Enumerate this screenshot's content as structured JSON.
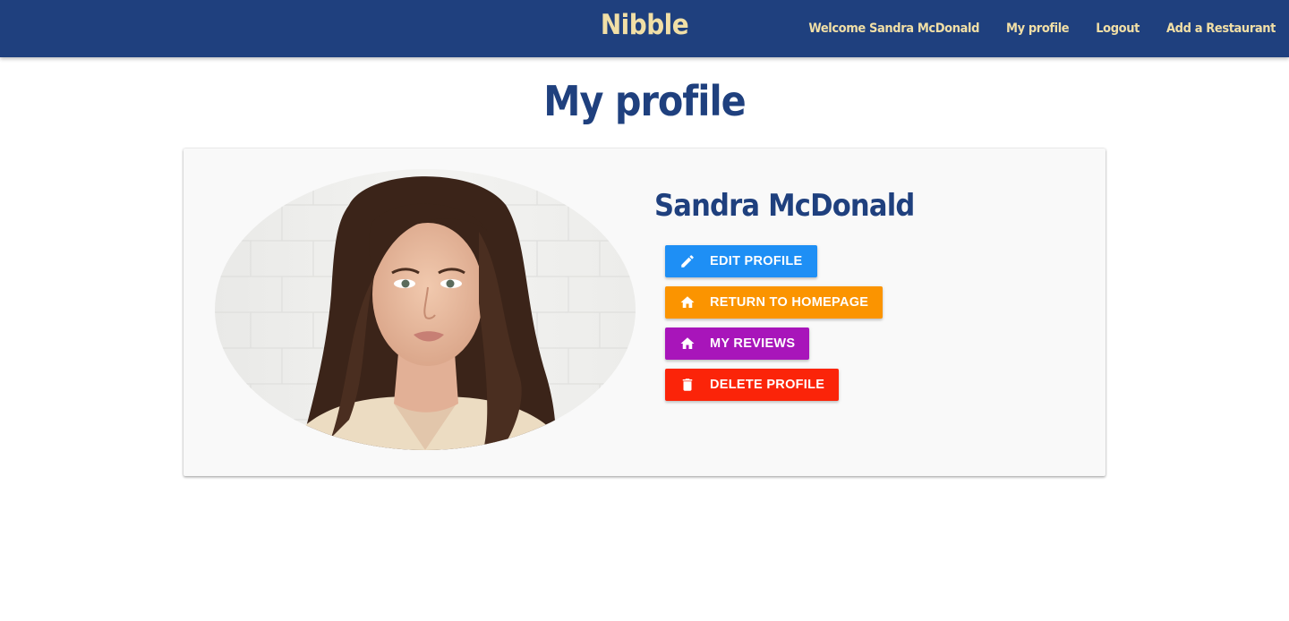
{
  "navbar": {
    "brand": "Nibble",
    "links": [
      {
        "label": "Welcome Sandra McDonald"
      },
      {
        "label": "My profile"
      },
      {
        "label": "Logout"
      },
      {
        "label": "Add a Restaurant"
      }
    ]
  },
  "page": {
    "title": "My profile"
  },
  "profile": {
    "name": "Sandra McDonald",
    "buttons": [
      {
        "label": "EDIT PROFILE",
        "icon": "pencil-icon",
        "color": "#1e8ff5"
      },
      {
        "label": "RETURN TO HOMEPAGE",
        "icon": "home-icon",
        "color": "#fb9400"
      },
      {
        "label": "MY REVIEWS",
        "icon": "home-icon",
        "color": "#a815ba"
      },
      {
        "label": "DELETE PROFILE",
        "icon": "trash-icon",
        "color": "#fb2409"
      }
    ]
  },
  "colors": {
    "navbar_bg": "#1f407e",
    "brand_text": "#f1dfa6",
    "title_text": "#1f407e",
    "card_bg": "#f9f9f9"
  }
}
